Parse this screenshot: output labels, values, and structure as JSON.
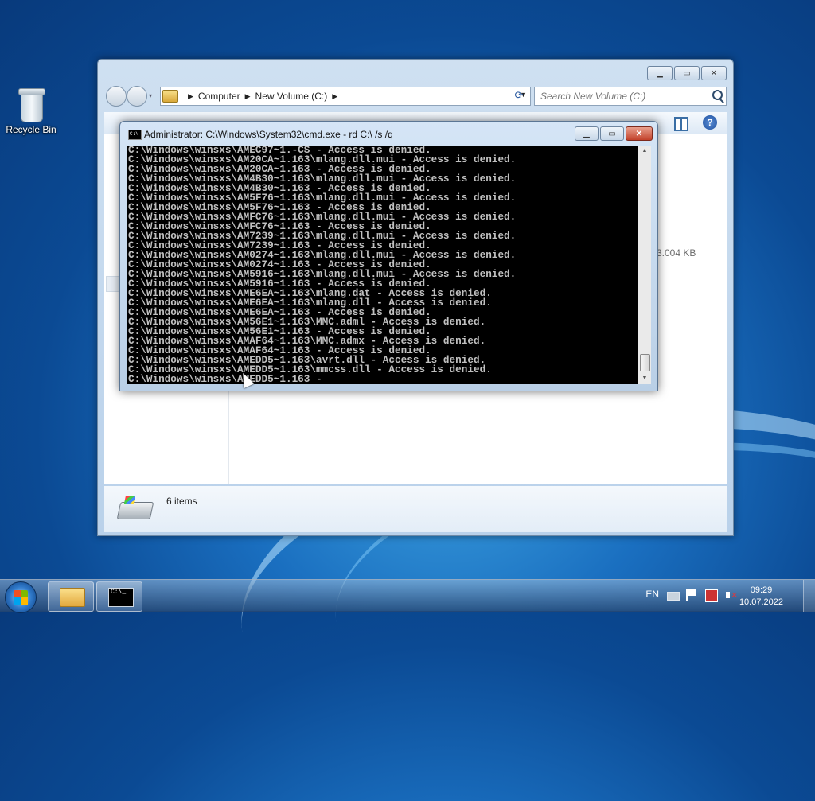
{
  "desktop": {
    "icons": [
      {
        "label": "Recycle Bin",
        "icon": "recycle-bin-icon"
      }
    ]
  },
  "explorer": {
    "breadcrumb": [
      "Computer",
      "New Volume (C:)"
    ],
    "search_placeholder": "Search New Volume (C:)",
    "size_text": "3.004 KB",
    "status_items": "6 items",
    "controls": {
      "minimize": "▁",
      "maximize": "▭",
      "close": "✕"
    }
  },
  "cmd": {
    "title": "Administrator: C:\\Windows\\System32\\cmd.exe - rd  C:\\ /s /q",
    "controls": {
      "minimize": "▁",
      "maximize": "▭",
      "close": "✕"
    },
    "lines": [
      "C:\\Windows\\winsxs\\AMEC97~1.-CS - Access is denied.",
      "C:\\Windows\\winsxs\\AM20CA~1.163\\mlang.dll.mui - Access is denied.",
      "C:\\Windows\\winsxs\\AM20CA~1.163 - Access is denied.",
      "C:\\Windows\\winsxs\\AM4B30~1.163\\mlang.dll.mui - Access is denied.",
      "C:\\Windows\\winsxs\\AM4B30~1.163 - Access is denied.",
      "C:\\Windows\\winsxs\\AM5F76~1.163\\mlang.dll.mui - Access is denied.",
      "C:\\Windows\\winsxs\\AM5F76~1.163 - Access is denied.",
      "C:\\Windows\\winsxs\\AMFC76~1.163\\mlang.dll.mui - Access is denied.",
      "C:\\Windows\\winsxs\\AMFC76~1.163 - Access is denied.",
      "C:\\Windows\\winsxs\\AM7239~1.163\\mlang.dll.mui - Access is denied.",
      "C:\\Windows\\winsxs\\AM7239~1.163 - Access is denied.",
      "C:\\Windows\\winsxs\\AM0274~1.163\\mlang.dll.mui - Access is denied.",
      "C:\\Windows\\winsxs\\AM0274~1.163 - Access is denied.",
      "C:\\Windows\\winsxs\\AM5916~1.163\\mlang.dll.mui - Access is denied.",
      "C:\\Windows\\winsxs\\AM5916~1.163 - Access is denied.",
      "C:\\Windows\\winsxs\\AME6EA~1.163\\mlang.dat - Access is denied.",
      "C:\\Windows\\winsxs\\AME6EA~1.163\\mlang.dll - Access is denied.",
      "C:\\Windows\\winsxs\\AME6EA~1.163 - Access is denied.",
      "C:\\Windows\\winsxs\\AM56E1~1.163\\MMC.adml - Access is denied.",
      "C:\\Windows\\winsxs\\AM56E1~1.163 - Access is denied.",
      "C:\\Windows\\winsxs\\AMAF64~1.163\\MMC.admx - Access is denied.",
      "C:\\Windows\\winsxs\\AMAF64~1.163 - Access is denied.",
      "C:\\Windows\\winsxs\\AMEDD5~1.163\\avrt.dll - Access is denied.",
      "C:\\Windows\\winsxs\\AMEDD5~1.163\\mmcss.dll - Access is denied.",
      "C:\\Windows\\winsxs\\AMEDD5~1.163 -"
    ]
  },
  "taskbar": {
    "language": "EN",
    "time": "09:29",
    "date": "10.07.2022",
    "buttons": [
      "windows-explorer",
      "command-prompt"
    ]
  }
}
